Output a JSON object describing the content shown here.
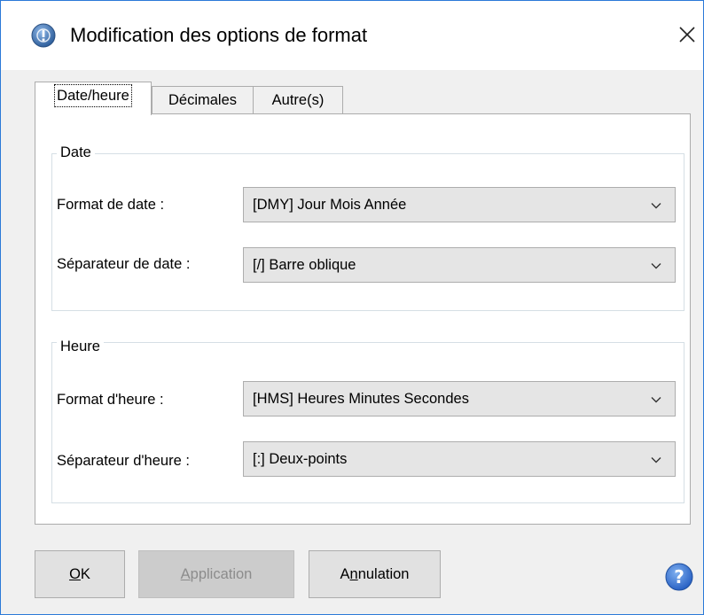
{
  "window": {
    "title": "Modification des options de format"
  },
  "tabs": [
    {
      "label": "Date/heure",
      "active": true
    },
    {
      "label": "Décimales",
      "active": false
    },
    {
      "label": "Autre(s)",
      "active": false
    }
  ],
  "date_group": {
    "title": "Date",
    "format_label": "Format de date :",
    "format_value": "[DMY] Jour Mois Année",
    "separator_label": "Séparateur de date :",
    "separator_value": "[/] Barre oblique"
  },
  "time_group": {
    "title": "Heure",
    "format_label": "Format d'heure :",
    "format_value": "[HMS] Heures Minutes Secondes",
    "separator_label": "Séparateur d'heure :",
    "separator_value": "[:] Deux-points"
  },
  "buttons": {
    "ok_mnemonic": "O",
    "ok_rest": "K",
    "apply_first": "A",
    "apply_rest": "pplication",
    "cancel_first": "A",
    "cancel_mnemonic": "n",
    "cancel_rest": "nulation"
  },
  "colors": {
    "accent": "#2b79d8",
    "help": "#3a7bd5"
  }
}
